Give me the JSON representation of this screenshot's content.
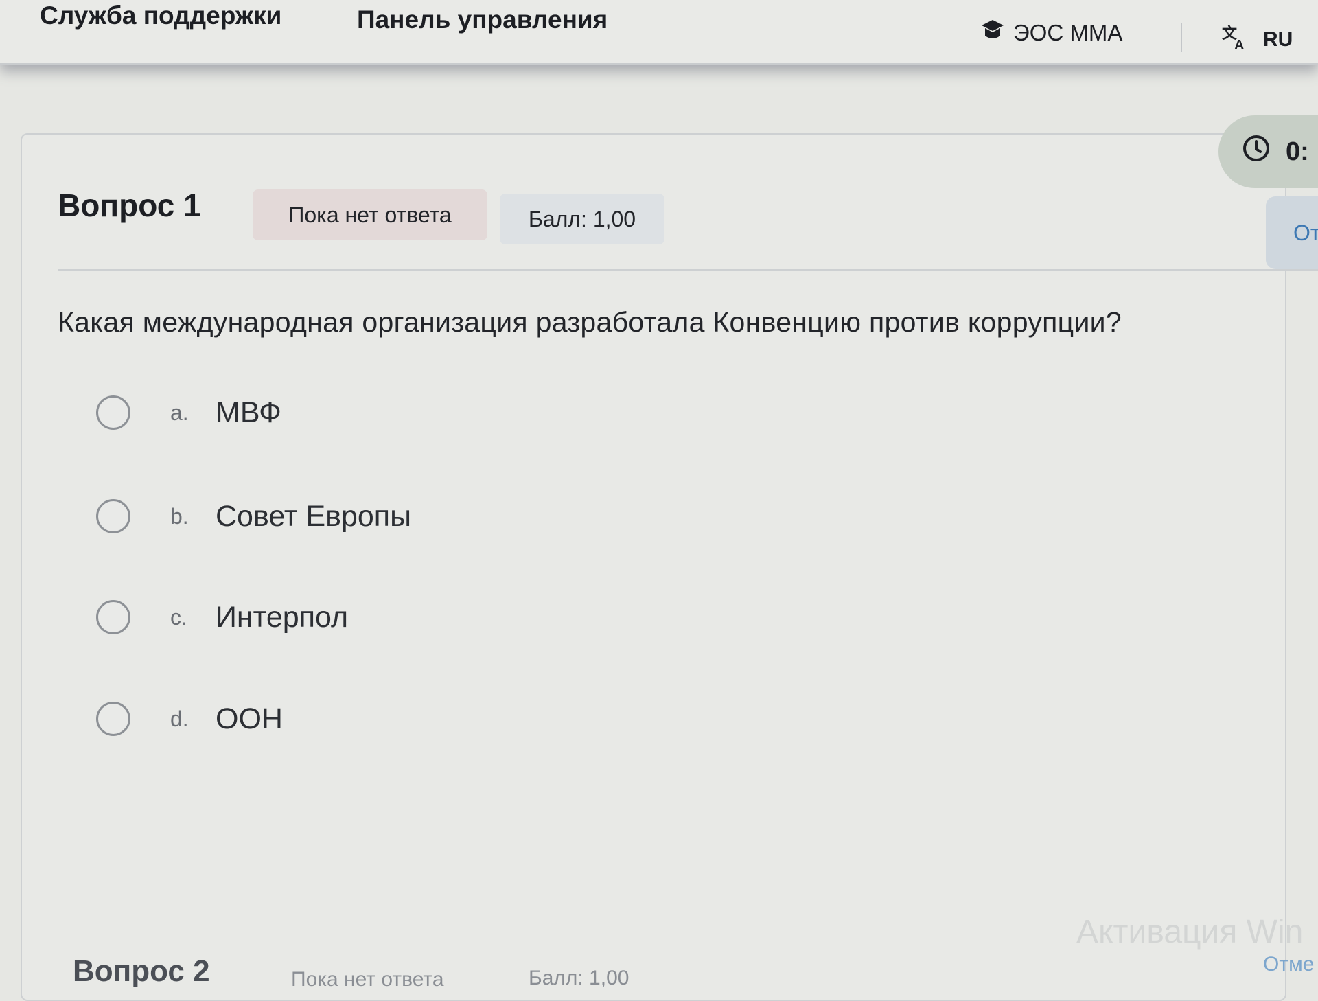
{
  "nav": {
    "support": "Служба поддержки",
    "panel": "Панель управления",
    "site_name": "ЭОС ММА",
    "site_icon": "graduation-cap-icon",
    "lang_icon": "translate-icon",
    "lang": "RU"
  },
  "timer": {
    "icon": "clock-icon",
    "value": "0:"
  },
  "side_button": {
    "label": "От"
  },
  "question": {
    "title": "Вопрос 1",
    "status": "Пока нет ответа",
    "score": "Балл: 1,00",
    "text": "Какая международная организация разработала Конвенцию против коррупции?",
    "options": [
      {
        "letter": "a.",
        "label": "МВФ",
        "selected": false
      },
      {
        "letter": "b.",
        "label": "Совет Европы",
        "selected": false
      },
      {
        "letter": "c.",
        "label": "Интерпол",
        "selected": false
      },
      {
        "letter": "d.",
        "label": "ООН",
        "selected": false
      }
    ]
  },
  "next_question": {
    "title": "Вопрос 2",
    "status": "Пока нет ответа",
    "score": "Балл: 1,00"
  },
  "overlay": {
    "watermark": "Активация Win",
    "corner_link": "Отме"
  },
  "colors": {
    "page_bg": "#e6e7e3",
    "status_badge": "#e3d9d8",
    "score_badge": "#dde1e4",
    "timer_bg": "#c7cfc6",
    "link_blue": "#3d78b3"
  }
}
